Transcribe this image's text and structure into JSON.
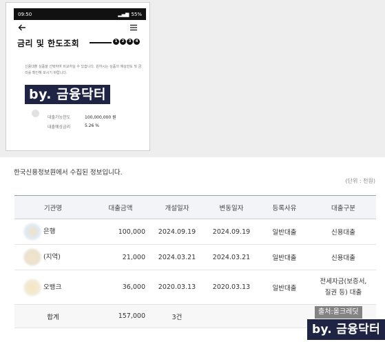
{
  "phone": {
    "status_bar": {
      "time": "09:50",
      "battery": "55%"
    },
    "title": "금리 및 한도조회",
    "steps": [
      "1",
      "2",
      "3",
      "4"
    ],
    "intro": "신용대출 상품을 선택하여 비교하실 수 있습니다. 원하시는 상품의 예상한도 및 금리를 확인해 보시기 바랍니다.",
    "watermark": "by. 금융닥터",
    "limit_label": "대출가능한도",
    "limit_value": "100,000,000 원",
    "rate_label": "대출예상금리",
    "rate_value": "5.26 %"
  },
  "panel": {
    "caption": "한국신용정보원에서 수집된 정보입니다.",
    "unit": "(단위 : 천원)",
    "columns": [
      "기관명",
      "대출금액",
      "개설일자",
      "변동일자",
      "등록사유",
      "대출구분"
    ],
    "rows": [
      {
        "institution": "은행",
        "amount": "100,000",
        "opened": "2024.09.19",
        "changed": "2024.09.19",
        "reason": "일반대출",
        "type": "신용대출"
      },
      {
        "institution": "(지역)",
        "amount": "21,000",
        "opened": "2024.03.21",
        "changed": "2024.03.21",
        "reason": "일반대출",
        "type": "신용대출"
      },
      {
        "institution": "오뱅크",
        "amount": "36,000",
        "opened": "2020.03.13",
        "changed": "2020.03.13",
        "reason": "일반대출",
        "type_line1": "전세자금(보증서,",
        "type_line2": "질권 등) 대출"
      }
    ],
    "total": {
      "label": "합계",
      "amount": "157,000",
      "count": "3건"
    }
  },
  "credit": {
    "source": "출처:올크레딧",
    "watermark": "by. 금융닥터"
  }
}
